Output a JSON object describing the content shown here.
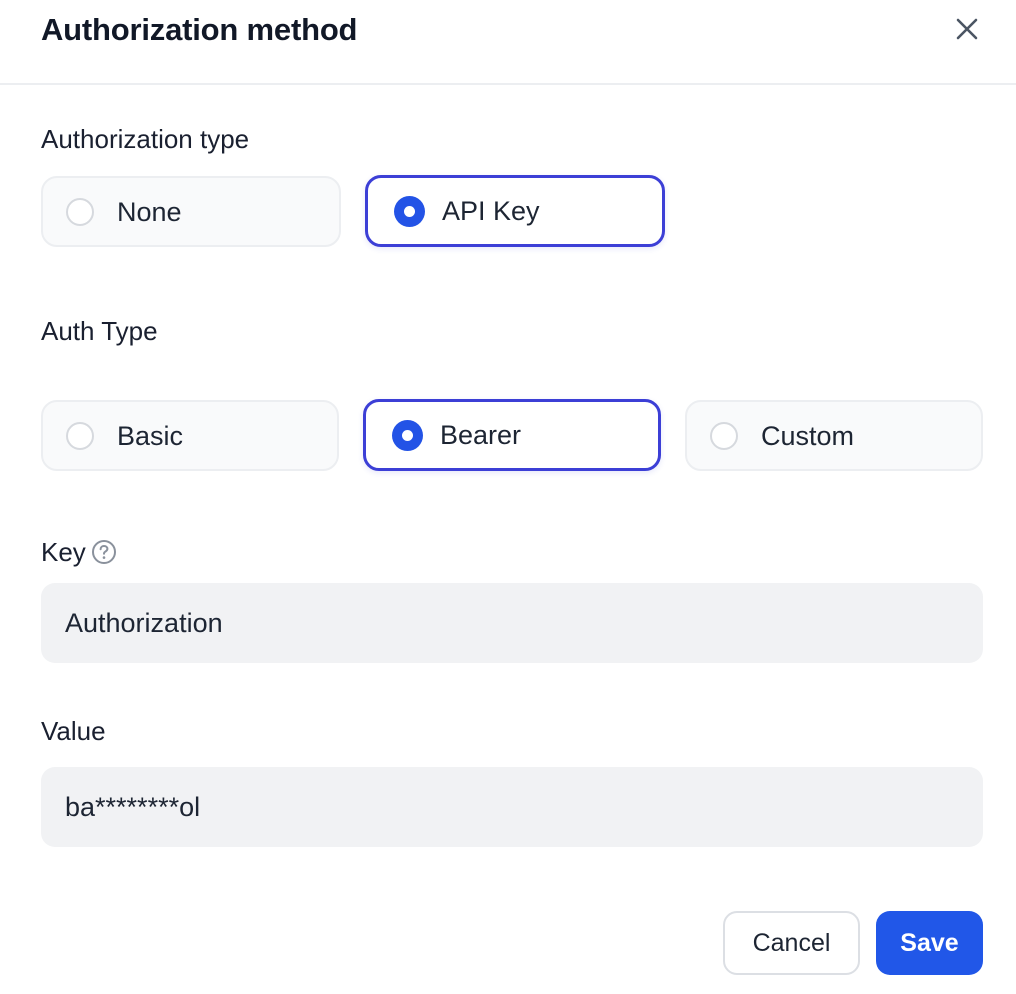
{
  "dialog": {
    "title": "Authorization method",
    "close_icon": "close-icon"
  },
  "authorization_type": {
    "label": "Authorization type",
    "options": [
      {
        "label": "None",
        "selected": false
      },
      {
        "label": "API Key",
        "selected": true
      }
    ]
  },
  "auth_type": {
    "label": "Auth Type",
    "options": [
      {
        "label": "Basic",
        "selected": false
      },
      {
        "label": "Bearer",
        "selected": true
      },
      {
        "label": "Custom",
        "selected": false
      }
    ]
  },
  "key_field": {
    "label": "Key",
    "help_icon": "question-circle-icon",
    "value": "Authorization"
  },
  "value_field": {
    "label": "Value",
    "value": "ba********ol"
  },
  "footer": {
    "cancel_label": "Cancel",
    "save_label": "Save"
  },
  "colors": {
    "accent": "#2353e6",
    "selected_border": "#3c3fd6",
    "save_button": "#2157e8",
    "input_background": "#f1f2f4"
  }
}
